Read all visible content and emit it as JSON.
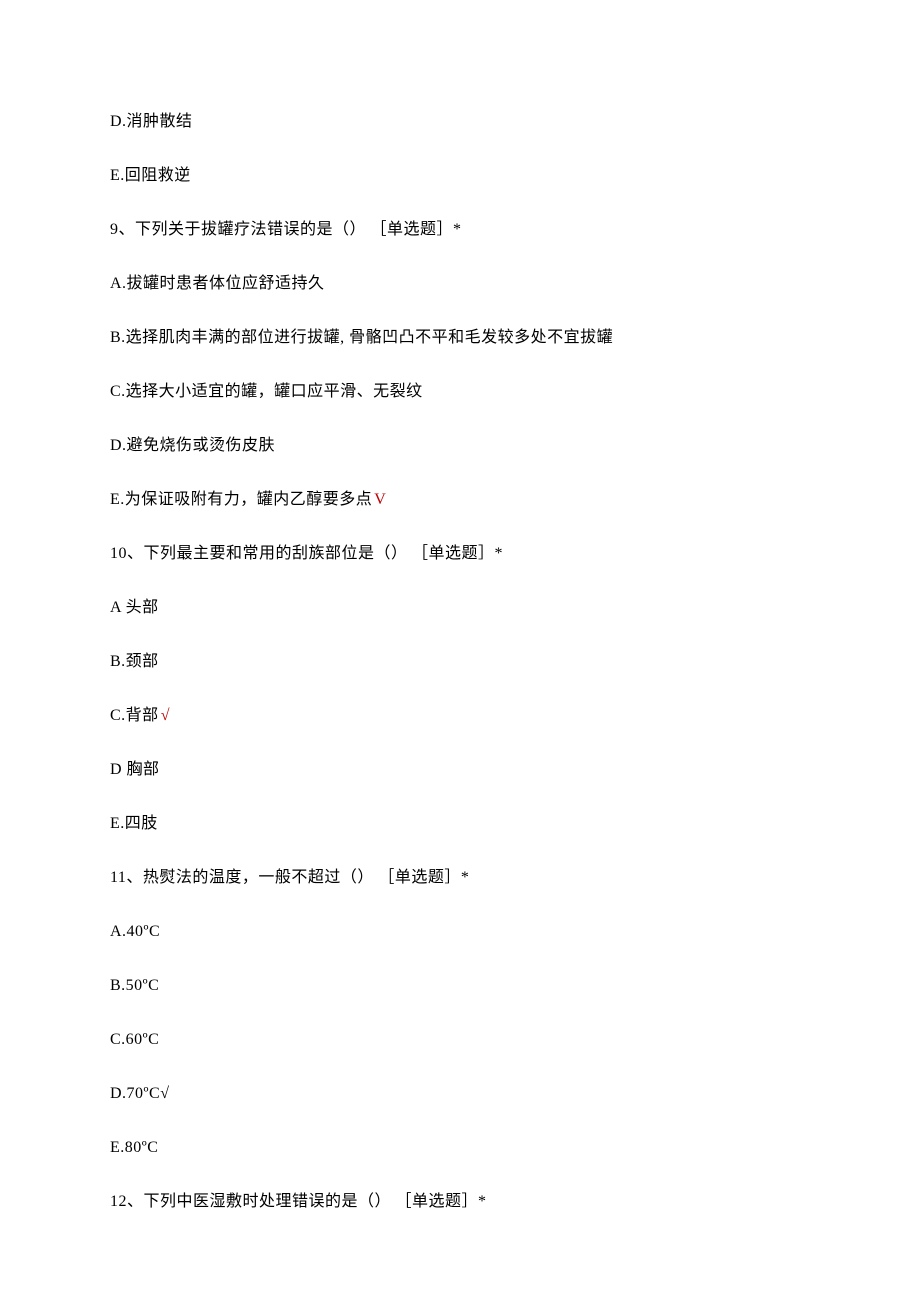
{
  "lines": [
    {
      "text": "D.消肿散结",
      "mark": ""
    },
    {
      "text": "E.回阻救逆",
      "mark": ""
    },
    {
      "text": "9、下列关于拔罐疗法错误的是（） ［单选题］*",
      "mark": ""
    },
    {
      "text": "A.拔罐时患者体位应舒适持久",
      "mark": ""
    },
    {
      "text": "B.选择肌肉丰满的部位进行拔罐, 骨骼凹凸不平和毛发较多处不宜拔罐",
      "mark": ""
    },
    {
      "text": "C.选择大小适宜的罐，罐口应平滑、无裂纹",
      "mark": ""
    },
    {
      "text": "D.避免烧伤或烫伤皮肤",
      "mark": ""
    },
    {
      "text": "E.为保证吸附有力，罐内乙醇要多点",
      "mark": "V"
    },
    {
      "text": "10、下列最主要和常用的刮族部位是（） ［单选题］*",
      "mark": ""
    },
    {
      "text": "A 头部",
      "mark": ""
    },
    {
      "text": "B.颈部",
      "mark": ""
    },
    {
      "text": "C.背部",
      "mark": "√"
    },
    {
      "text": "D 胸部",
      "mark": ""
    },
    {
      "text": "E.四肢",
      "mark": ""
    },
    {
      "text": "11、热熨法的温度，一般不超过（） ［单选题］*",
      "mark": ""
    },
    {
      "text": "A.40ºC",
      "mark": ""
    },
    {
      "text": "B.50ºC",
      "mark": ""
    },
    {
      "text": "C.60ºC",
      "mark": ""
    },
    {
      "text": "D.70ºC√",
      "mark": ""
    },
    {
      "text": "E.80ºC",
      "mark": ""
    },
    {
      "text": "12、下列中医湿敷时处理错误的是（） ［单选题］*",
      "mark": ""
    }
  ]
}
